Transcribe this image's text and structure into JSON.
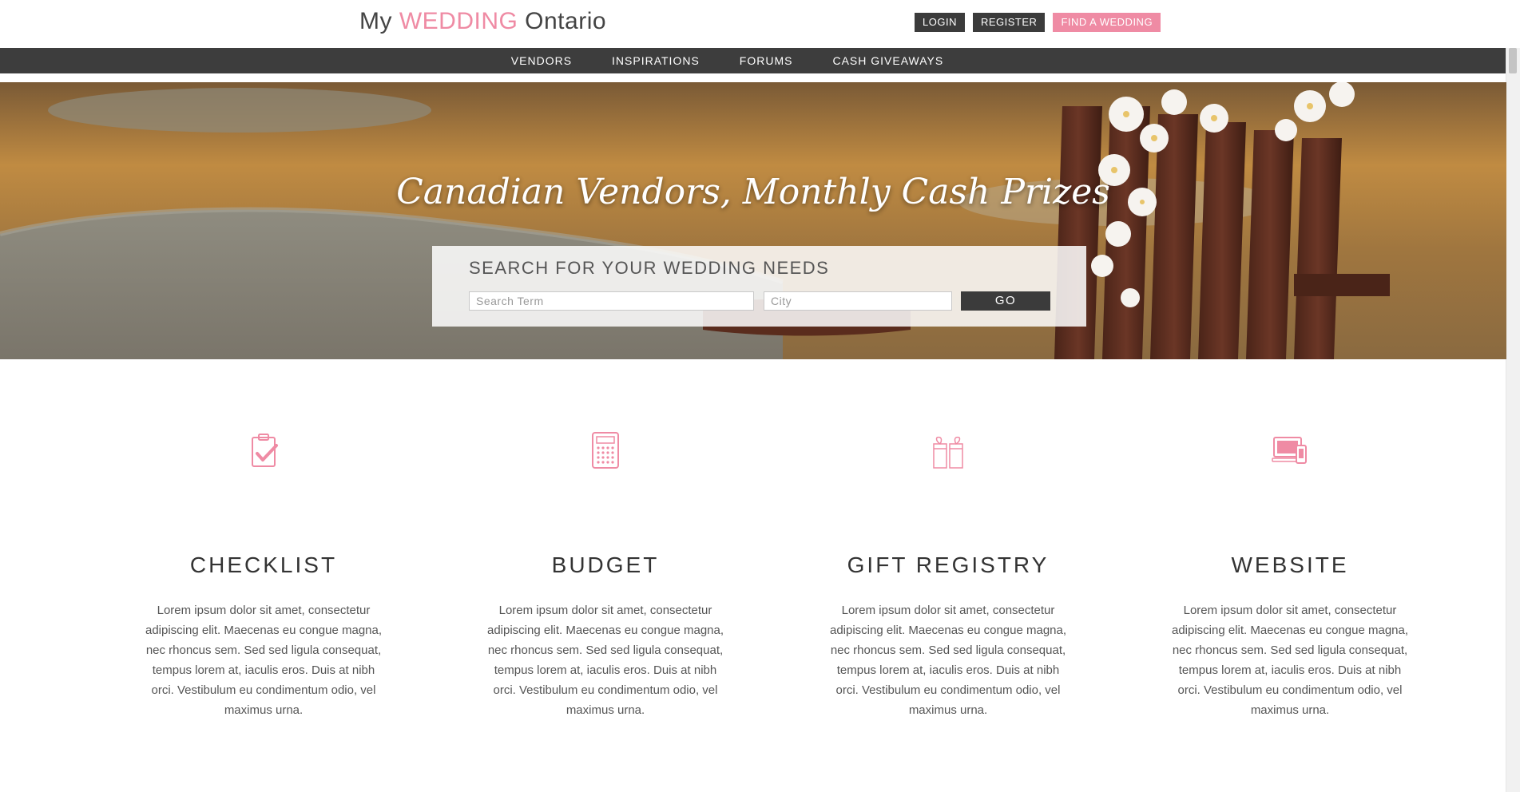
{
  "brand": {
    "prefix": "My ",
    "highlight": "WEDDING",
    "suffix": " Ontario",
    "accent_color": "#ef8ba4"
  },
  "auth": {
    "login": "LOGIN",
    "register": "REGISTER",
    "find_wedding": "FIND A WEDDING"
  },
  "nav": {
    "items": [
      "VENDORS",
      "INSPIRATIONS",
      "FORUMS",
      "CASH GIVEAWAYS"
    ]
  },
  "hero": {
    "title": "Canadian Vendors, Monthly Cash Prizes",
    "search_label": "SEARCH FOR YOUR WEDDING NEEDS",
    "term_placeholder": "Search Term",
    "city_placeholder": "City",
    "go_label": "GO"
  },
  "features": [
    {
      "icon": "clipboard-check-icon",
      "title": "CHECKLIST",
      "desc": "Lorem ipsum dolor sit amet, consectetur adipiscing elit. Maecenas eu congue magna, nec rhoncus sem. Sed sed ligula consequat, tempus lorem at, iaculis eros. Duis at nibh orci. Vestibulum eu condimentum odio, vel maximus urna."
    },
    {
      "icon": "calculator-icon",
      "title": "BUDGET",
      "desc": "Lorem ipsum dolor sit amet, consectetur adipiscing elit. Maecenas eu congue magna, nec rhoncus sem. Sed sed ligula consequat, tempus lorem at, iaculis eros. Duis at nibh orci. Vestibulum eu condimentum odio, vel maximus urna."
    },
    {
      "icon": "gift-icon",
      "title": "GIFT REGISTRY",
      "desc": "Lorem ipsum dolor sit amet, consectetur adipiscing elit. Maecenas eu congue magna, nec rhoncus sem. Sed sed ligula consequat, tempus lorem at, iaculis eros. Duis at nibh orci. Vestibulum eu condimentum odio, vel maximus urna."
    },
    {
      "icon": "devices-icon",
      "title": "WEBSITE",
      "desc": "Lorem ipsum dolor sit amet, consectetur adipiscing elit. Maecenas eu congue magna, nec rhoncus sem. Sed sed ligula consequat, tempus lorem at, iaculis eros. Duis at nibh orci. Vestibulum eu condimentum odio, vel maximus urna."
    }
  ],
  "colors": {
    "dark": "#3b3b3b",
    "pink": "#ef8ba4"
  }
}
